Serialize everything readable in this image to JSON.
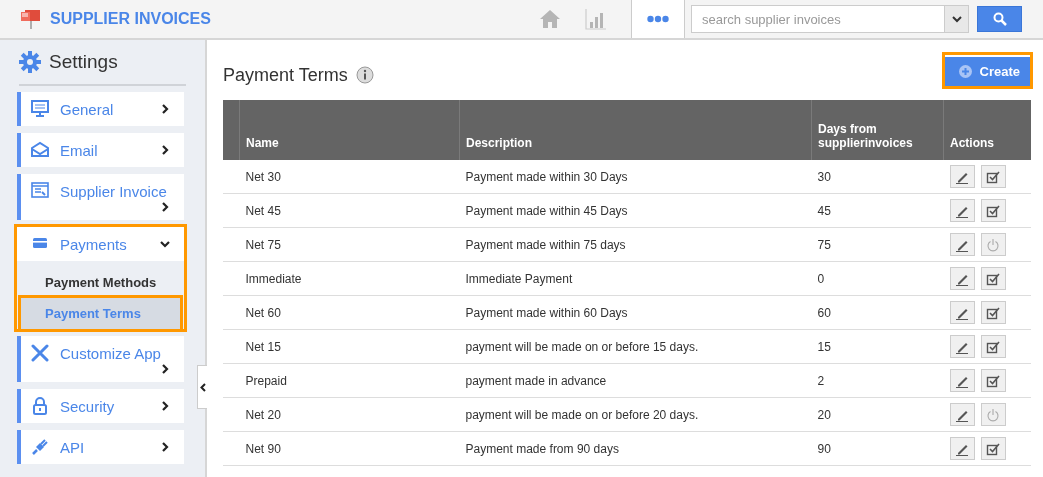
{
  "header": {
    "app_title": "SUPPLIER INVOICES",
    "search": {
      "placeholder": "search supplier invoices"
    }
  },
  "sidebar": {
    "title": "Settings",
    "items": [
      {
        "label": "General",
        "kind": "monitor",
        "expanded": false,
        "highlighted": false
      },
      {
        "label": "Email",
        "kind": "envelope",
        "expanded": false,
        "highlighted": false
      },
      {
        "label": "Supplier Invoice",
        "kind": "window",
        "expanded": false,
        "highlighted": false
      },
      {
        "label": "Payments",
        "kind": "card",
        "expanded": true,
        "highlighted": true,
        "children": [
          {
            "label": "Payment Methods",
            "selected": false,
            "highlighted": false
          },
          {
            "label": "Payment Terms",
            "selected": true,
            "highlighted": true
          }
        ]
      },
      {
        "label": "Customize App",
        "kind": "tools",
        "expanded": false,
        "highlighted": false
      },
      {
        "label": "Security",
        "kind": "lock",
        "expanded": false,
        "highlighted": false
      },
      {
        "label": "API",
        "kind": "plug",
        "expanded": false,
        "highlighted": false
      }
    ]
  },
  "page": {
    "title": "Payment Terms",
    "create_button": {
      "label": "Create",
      "highlighted": true
    }
  },
  "table": {
    "columns": [
      "Name",
      "Description",
      "Days from supplierinvoices",
      "Actions"
    ],
    "rows": [
      {
        "name": "Net 30",
        "description": "Payment made within 30 Days",
        "days": "30",
        "kind": "check"
      },
      {
        "name": "Net 45",
        "description": "Payment made within 45 Days",
        "days": "45",
        "kind": "check"
      },
      {
        "name": "Net 75",
        "description": "Payment made within 75 days",
        "days": "75",
        "kind": "power"
      },
      {
        "name": "Immediate",
        "description": "Immediate Payment",
        "days": "0",
        "kind": "check"
      },
      {
        "name": "Net 60",
        "description": "Payment made within 60 Days",
        "days": "60",
        "kind": "check"
      },
      {
        "name": "Net 15",
        "description": "payment will be made on or before 15 days.",
        "days": "15",
        "kind": "check"
      },
      {
        "name": "Prepaid",
        "description": "payment made in advance",
        "days": "2",
        "kind": "check"
      },
      {
        "name": "Net 20",
        "description": "payment will be made on or before 20 days.",
        "days": "20",
        "kind": "power"
      },
      {
        "name": "Net 90",
        "description": "Payment made from 90 days",
        "days": "90",
        "kind": "check"
      }
    ]
  }
}
